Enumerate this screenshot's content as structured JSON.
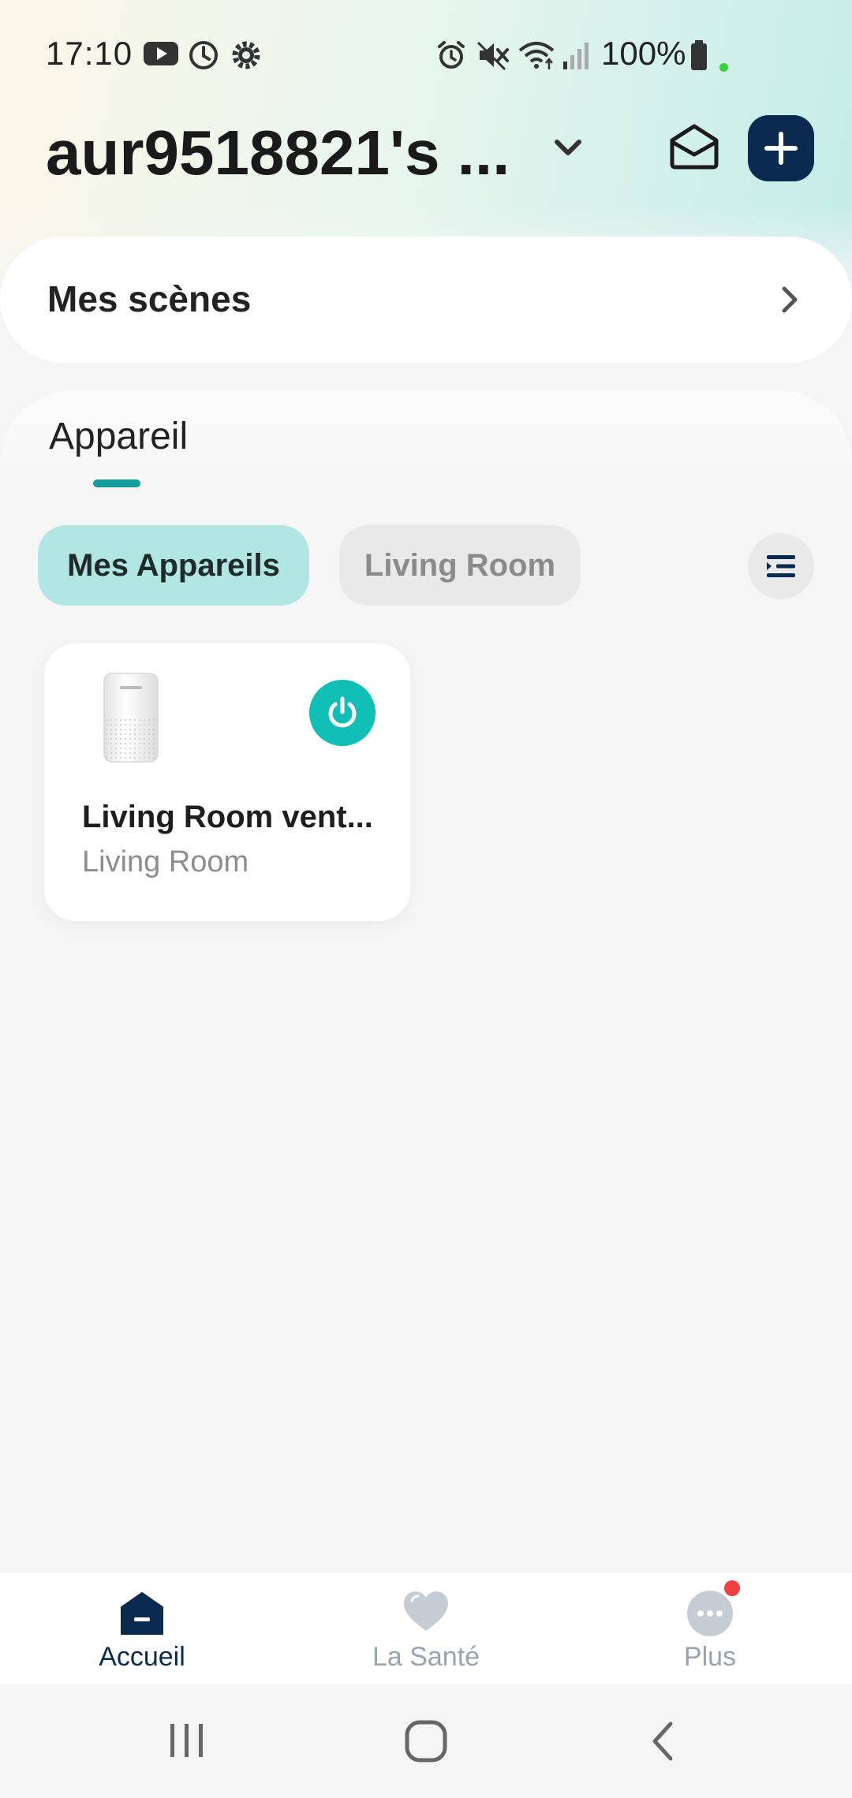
{
  "status_bar": {
    "time": "17:10",
    "battery": "100%",
    "icons": [
      "youtube-icon",
      "clock-icon",
      "settings-icon",
      "alarm-icon",
      "mute-icon",
      "wifi-icon",
      "signal-icon",
      "battery-icon"
    ]
  },
  "header": {
    "title": "aur9518821's ...",
    "icons": [
      "chevron-down-icon",
      "mail-icon",
      "plus-icon"
    ]
  },
  "scenes": {
    "label": "Mes scènes"
  },
  "devices_section": {
    "tab_label": "Appareil",
    "chips": [
      {
        "label": "Mes Appareils",
        "active": true
      },
      {
        "label": "Living Room",
        "active": false
      }
    ],
    "devices": [
      {
        "name": "Living Room vent...",
        "room": "Living Room",
        "power_on": true
      }
    ]
  },
  "bottom_nav": {
    "items": [
      {
        "label": "Accueil",
        "icon": "home-icon",
        "active": true
      },
      {
        "label": "La Santé",
        "icon": "heart-icon",
        "active": false
      },
      {
        "label": "Plus",
        "icon": "more-icon",
        "active": false,
        "badge": true
      }
    ]
  },
  "colors": {
    "accent": "#12bfb7",
    "navy": "#0b2a4f",
    "chip_active": "#b2e6e3",
    "badge": "#ef4141"
  }
}
